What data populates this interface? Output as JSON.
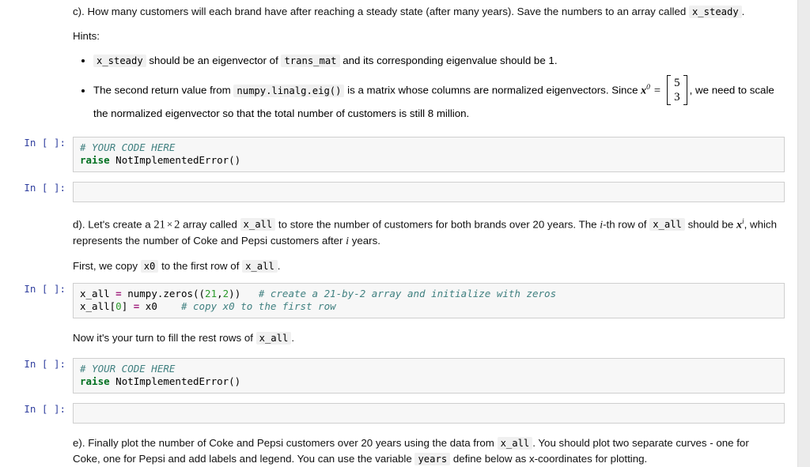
{
  "notebook": {
    "prompt_label": "In [ ]:",
    "cells": [
      {
        "type": "markdown",
        "name": "question-c",
        "para_c_pre": "c). How many customers will each brand have after reaching a steady state (after many years). Save the numbers to an array called ",
        "para_c_code": "x_steady",
        "para_c_post": ".",
        "hints_label": "Hints:",
        "hint1_a": "",
        "hint1_code1": "x_steady",
        "hint1_b": " should be an eigenvector of ",
        "hint1_code2": "trans_mat",
        "hint1_c": " and its corresponding eigenvalue should be 1.",
        "hint2_a": "The second return value from ",
        "hint2_code1": "numpy.linalg.eig()",
        "hint2_b": " is a matrix whose columns are normalized eigenvectors. Since ",
        "hint2_math_x": "x",
        "hint2_math_sup": "0",
        "hint2_equals": "=",
        "hint2_vec_top": "5",
        "hint2_vec_bottom": "3",
        "hint2_c": ", we need to scale",
        "hint2_d": "the normalized eigenvector so that the total number of customers is still 8 million."
      },
      {
        "type": "code",
        "name": "code-cell-your-code-1",
        "lines": [
          [
            {
              "t": "comment",
              "v": "# YOUR CODE HERE"
            }
          ],
          [
            {
              "t": "keyword",
              "v": "raise"
            },
            {
              "t": "plain",
              "v": " NotImplementedError()"
            }
          ]
        ]
      },
      {
        "type": "code",
        "name": "code-cell-empty-1",
        "lines": []
      },
      {
        "type": "markdown",
        "name": "question-d",
        "para_d_a": "d). Let's create a ",
        "para_d_dim1": "21",
        "para_d_times": "×",
        "para_d_dim2": "2",
        "para_d_b": " array called ",
        "para_d_code1": "x_all",
        "para_d_c": " to store the number of customers for both brands over 20 years. The ",
        "para_d_i": "i",
        "para_d_d": "-th row of ",
        "para_d_code2": "x_all",
        "para_d_e": " should be ",
        "para_d_x": "x",
        "para_d_xsup": "i",
        "para_d_f": ", which represents the number of Coke and Pepsi customers after ",
        "para_d_i2": "i",
        "para_d_g": " years.",
        "para_first_a": "First, we copy ",
        "para_first_code1": "x0",
        "para_first_b": " to the first row of ",
        "para_first_code2": "x_all",
        "para_first_c": "."
      },
      {
        "type": "code",
        "name": "code-cell-x-all-init",
        "lines": [
          [
            {
              "t": "plain",
              "v": "x_all "
            },
            {
              "t": "op",
              "v": "="
            },
            {
              "t": "plain",
              "v": " numpy.zeros(("
            },
            {
              "t": "num",
              "v": "21"
            },
            {
              "t": "plain",
              "v": ","
            },
            {
              "t": "num",
              "v": "2"
            },
            {
              "t": "plain",
              "v": "))   "
            },
            {
              "t": "comment",
              "v": "# create a 21-by-2 array and initialize with zeros"
            }
          ],
          [
            {
              "t": "plain",
              "v": "x_all["
            },
            {
              "t": "num",
              "v": "0"
            },
            {
              "t": "plain",
              "v": "] "
            },
            {
              "t": "op",
              "v": "="
            },
            {
              "t": "plain",
              "v": " x0    "
            },
            {
              "t": "comment",
              "v": "# copy x0 to the first row"
            }
          ]
        ]
      },
      {
        "type": "markdown",
        "name": "instruction-fill-rest",
        "para_now_a": "Now it's your turn to fill the rest rows of ",
        "para_now_code": "x_all",
        "para_now_b": "."
      },
      {
        "type": "code",
        "name": "code-cell-your-code-2",
        "lines": [
          [
            {
              "t": "comment",
              "v": "# YOUR CODE HERE"
            }
          ],
          [
            {
              "t": "keyword",
              "v": "raise"
            },
            {
              "t": "plain",
              "v": " NotImplementedError()"
            }
          ]
        ]
      },
      {
        "type": "code",
        "name": "code-cell-empty-2",
        "lines": []
      },
      {
        "type": "markdown",
        "name": "question-e",
        "para_e_a": "e). Finally plot the number of Coke and Pepsi customers over 20 years using the data from ",
        "para_e_code1": "x_all",
        "para_e_b": ". You should plot two separate curves - one for Coke, one for Pepsi and add labels and legend. You can use the variable ",
        "para_e_code2": "years",
        "para_e_c": " define below as x-coordinates for plotting."
      }
    ]
  },
  "colors": {
    "prompt": "#303f9f",
    "code_background": "#f7f7f7",
    "code_border": "#cfcfcf",
    "inline_code_background": "#f0f0f0",
    "comment": "#408080",
    "keyword": "#007020",
    "operator": "#a2247f",
    "number": "#2b9a2b",
    "page_background": "#ffffff",
    "gutter": "#ebebeb"
  }
}
